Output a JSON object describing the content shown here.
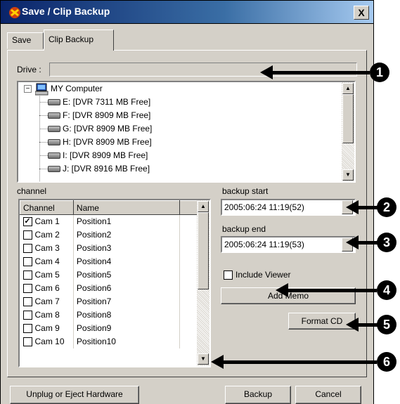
{
  "window": {
    "title": "Save / Clip Backup",
    "close_label": "X"
  },
  "tabs": [
    {
      "label": "Save"
    },
    {
      "label": "Clip Backup"
    }
  ],
  "drive": {
    "label": "Drive :",
    "value": ""
  },
  "tree": {
    "root": "MY Computer",
    "drives": [
      "E: [DVR 7311 MB Free]",
      "F: [DVR 8909 MB Free]",
      "G: [DVR 8909 MB Free]",
      "H: [DVR 8909 MB Free]",
      "I: [DVR 8909 MB Free]",
      "J: [DVR 8916 MB Free]"
    ]
  },
  "channel": {
    "label": "channel",
    "headers": {
      "channel": "Channel",
      "name": "Name"
    },
    "rows": [
      {
        "channel": "Cam 1",
        "name": "Position1",
        "checked": "✓"
      },
      {
        "channel": "Cam 2",
        "name": "Position2",
        "checked": ""
      },
      {
        "channel": "Cam 3",
        "name": "Position3",
        "checked": ""
      },
      {
        "channel": "Cam 4",
        "name": "Position4",
        "checked": ""
      },
      {
        "channel": "Cam 5",
        "name": "Position5",
        "checked": ""
      },
      {
        "channel": "Cam 6",
        "name": "Position6",
        "checked": ""
      },
      {
        "channel": "Cam 7",
        "name": "Position7",
        "checked": ""
      },
      {
        "channel": "Cam 8",
        "name": "Position8",
        "checked": ""
      },
      {
        "channel": "Cam 9",
        "name": "Position9",
        "checked": ""
      },
      {
        "channel": "Cam 10",
        "name": "Position10",
        "checked": ""
      }
    ]
  },
  "backup_start": {
    "label": "backup start",
    "value": "2005:06:24 11:19(52)"
  },
  "backup_end": {
    "label": "backup end",
    "value": "2005:06:24 11:19(53)"
  },
  "include_viewer": {
    "label": "Include Viewer"
  },
  "buttons": {
    "add_memo": "Add Memo",
    "format_cd": "Format CD",
    "unplug": "Unplug or Eject Hardware",
    "backup": "Backup",
    "cancel": "Cancel"
  },
  "callouts": [
    "1",
    "2",
    "3",
    "4",
    "5",
    "6"
  ]
}
